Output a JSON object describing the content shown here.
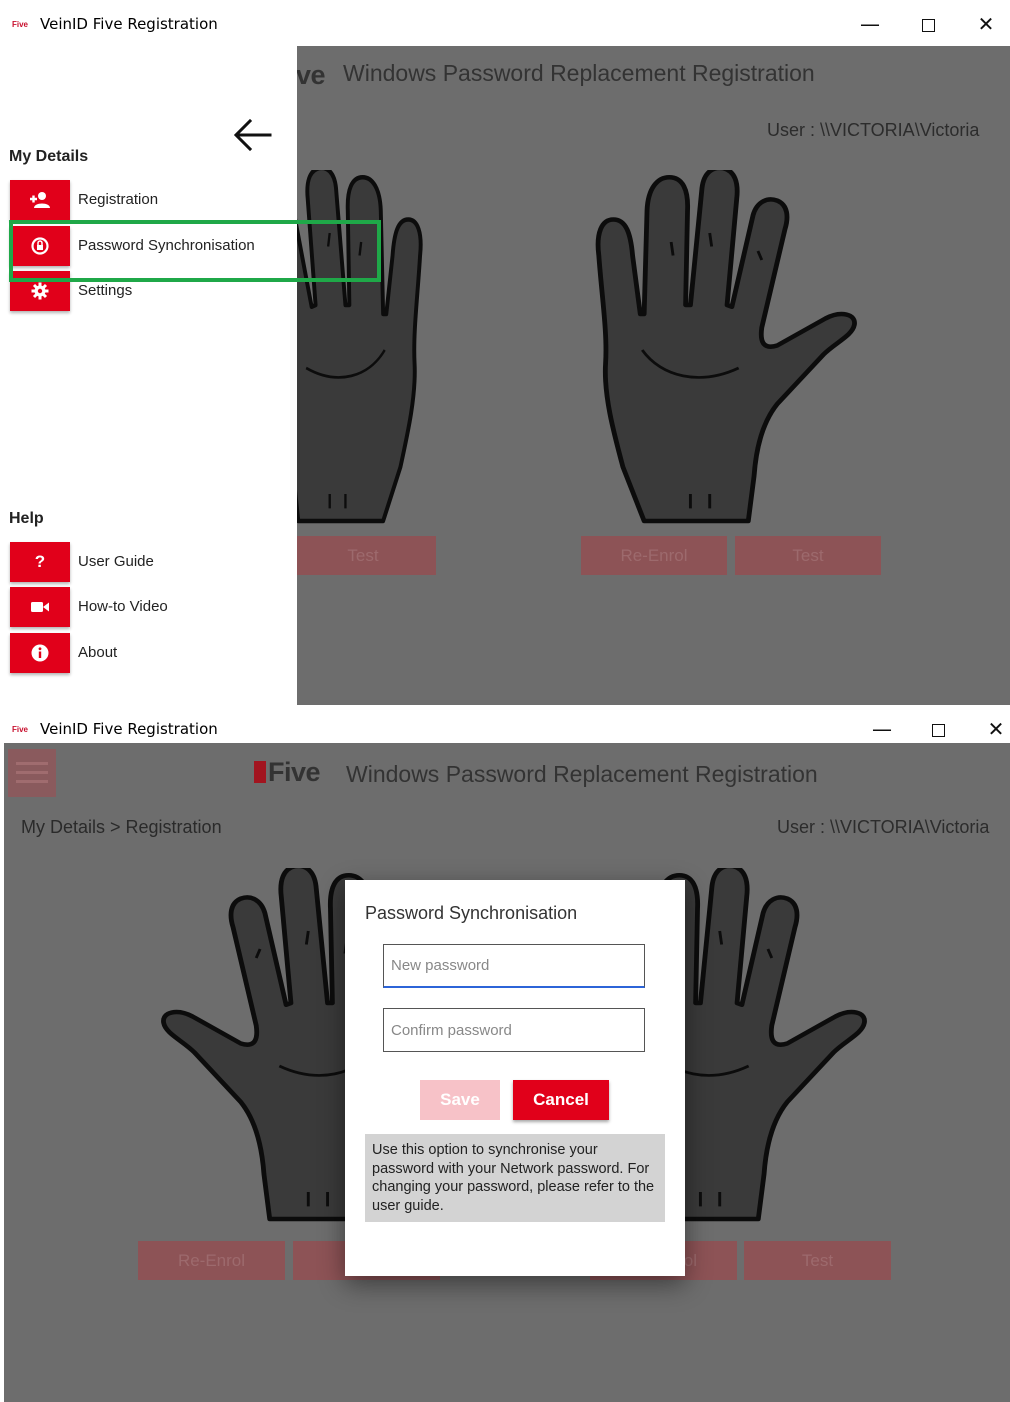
{
  "window": {
    "app_icon_text": "Five",
    "title": "VeinID Five Registration",
    "controls": {
      "minimize": "—",
      "close": "✕"
    }
  },
  "app": {
    "logo_text": "Five",
    "logo_partial_text": "ve",
    "heading": "Windows Password Replacement Registration",
    "user": "User : \\\\VICTORIA\\Victoria",
    "breadcrumb": "My Details > Registration",
    "buttons": {
      "re_enrol": "Re-Enrol",
      "test": "Test"
    },
    "colors": {
      "accent": "#e1001a",
      "highlight": "#1fa848",
      "overlay": "#6d6d6d"
    }
  },
  "drawer": {
    "my_details": {
      "title": "My Details",
      "items": [
        {
          "label": "Registration",
          "icon": "add-user-icon"
        },
        {
          "label": "Password Synchronisation",
          "icon": "lock-sync-icon"
        },
        {
          "label": "Settings",
          "icon": "gear-icon"
        }
      ]
    },
    "help": {
      "title": "Help",
      "items": [
        {
          "label": "User Guide",
          "icon": "question-icon",
          "glyph": "?"
        },
        {
          "label": "How-to Video",
          "icon": "video-camera-icon"
        },
        {
          "label": "About",
          "icon": "info-icon"
        }
      ]
    }
  },
  "dialog": {
    "title": "Password Synchronisation",
    "new_password_placeholder": "New password",
    "confirm_password_placeholder": "Confirm password",
    "save_label": "Save",
    "cancel_label": "Cancel",
    "info": "Use this option to synchronise your password with your Network password. For changing your password, please refer to the user guide."
  }
}
